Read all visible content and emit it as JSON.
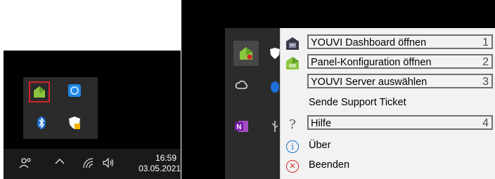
{
  "taskbar": {
    "time": "16:59",
    "date": "03.05.2021",
    "icons": [
      "people-icon",
      "chevron-up-icon",
      "network-icon",
      "volume-icon"
    ]
  },
  "tray_overflow": {
    "icons": [
      "youvi-app-icon",
      "vpn-icon",
      "bluetooth-icon",
      "windows-security-icon"
    ],
    "highlight_color": "#d2232a"
  },
  "right_tray": {
    "icons": [
      "youvi-app-icon",
      "windows-security-icon",
      "creative-cloud-icon",
      "blue-app-icon",
      "onenote-icon",
      "usb-icon"
    ]
  },
  "context_menu": {
    "items": [
      {
        "label": "YOUVI Dashboard öffnen",
        "number": "1",
        "icon": "youvi-dashboard-icon",
        "boxed": true
      },
      {
        "label": "Panel-Konfiguration öffnen",
        "number": "2",
        "icon": "youvi-panel-icon",
        "boxed": true
      },
      {
        "label": "YOUVI Server auswählen",
        "number": "3",
        "boxed": true
      },
      {
        "label": "Sende Support Ticket",
        "boxed": false
      },
      {
        "label": "Hilfe",
        "number": "4",
        "icon": "help-icon",
        "boxed": true
      },
      {
        "label": "Über",
        "icon": "info-icon",
        "boxed": false
      },
      {
        "label": "Beenden",
        "icon": "exit-icon",
        "boxed": false
      }
    ],
    "icon_glyphs": {
      "help": "?",
      "info": "i",
      "exit": "×"
    },
    "colors": {
      "accent_green": "#8cc63f",
      "info_blue": "#1a73c8",
      "exit_red": "#d32f2f"
    }
  }
}
